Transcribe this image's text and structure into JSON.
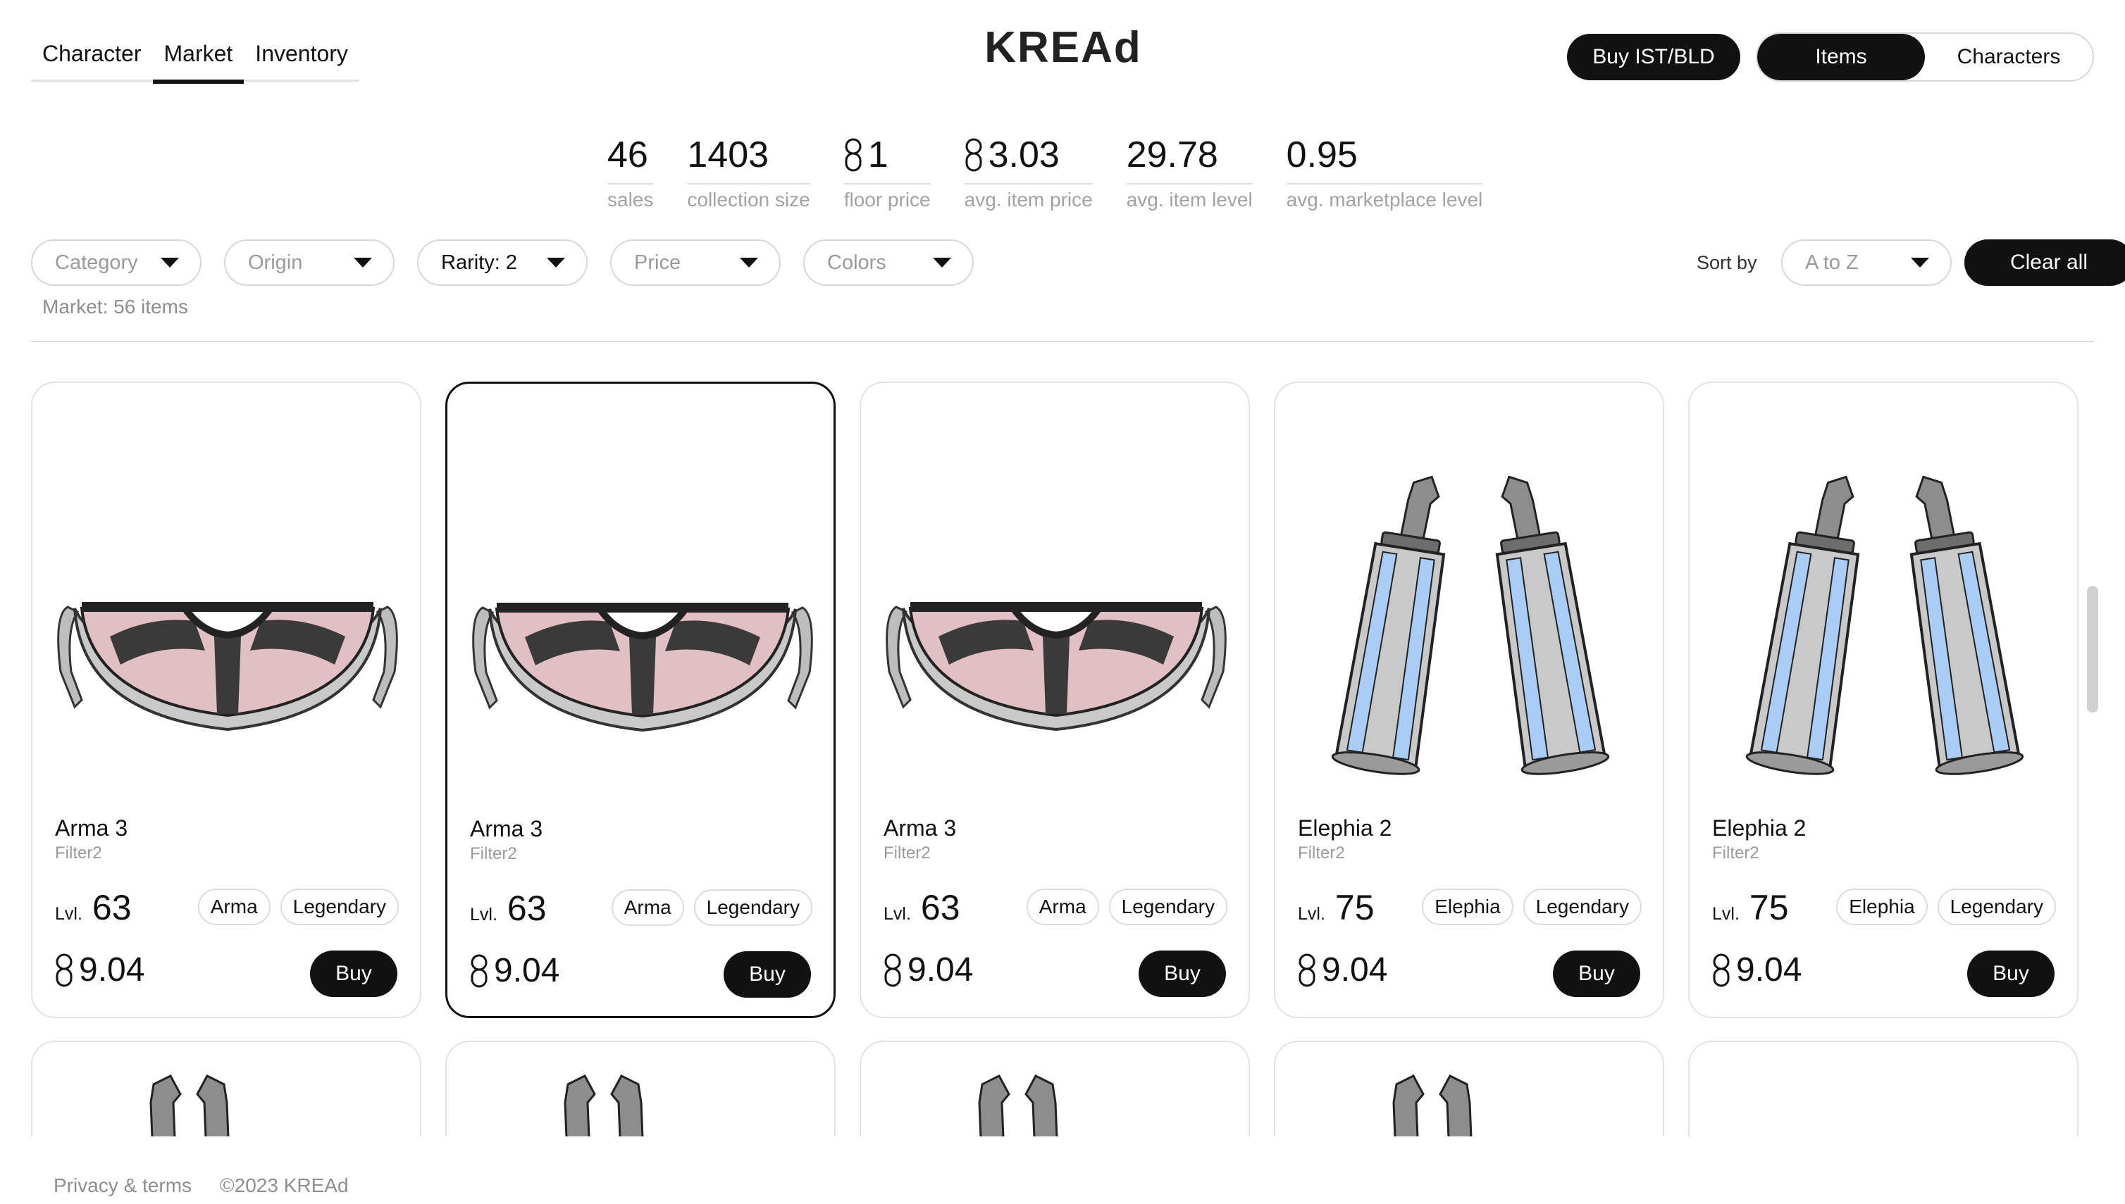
{
  "nav": {
    "tabs": [
      {
        "label": "Character",
        "active": false
      },
      {
        "label": "Market",
        "active": true
      },
      {
        "label": "Inventory",
        "active": false
      }
    ]
  },
  "logo": {
    "text": "KREAd"
  },
  "header": {
    "buy_label": "Buy IST/BLD",
    "segment": [
      {
        "label": "Items",
        "active": true
      },
      {
        "label": "Characters",
        "active": false
      }
    ]
  },
  "stats": [
    {
      "value": "46",
      "label": "sales",
      "coin": false
    },
    {
      "value": "1403",
      "label": "collection size",
      "coin": false
    },
    {
      "value": "1",
      "label": "floor price",
      "coin": true
    },
    {
      "value": "3.03",
      "label": "avg. item price",
      "coin": true
    },
    {
      "value": "29.78",
      "label": "avg. item level",
      "coin": false
    },
    {
      "value": "0.95",
      "label": "avg. marketplace level",
      "coin": false
    }
  ],
  "filters": {
    "category": "Category",
    "origin": "Origin",
    "rarity": "Rarity: 2",
    "price": "Price",
    "colors": "Colors",
    "sort_label": "Sort by",
    "sort_value": "A to Z",
    "clear_label": "Clear all",
    "market_count": "Market: 56 items"
  },
  "cards": [
    {
      "name": "Arma 3",
      "sub": "Filter2",
      "lvl_label": "Lvl.",
      "level": "63",
      "origin": "Arma",
      "rarity": "Legendary",
      "price": "9.04",
      "buy": "Buy",
      "kind": "mask",
      "selected": false
    },
    {
      "name": "Arma 3",
      "sub": "Filter2",
      "lvl_label": "Lvl.",
      "level": "63",
      "origin": "Arma",
      "rarity": "Legendary",
      "price": "9.04",
      "buy": "Buy",
      "kind": "mask",
      "selected": true
    },
    {
      "name": "Arma 3",
      "sub": "Filter2",
      "lvl_label": "Lvl.",
      "level": "63",
      "origin": "Arma",
      "rarity": "Legendary",
      "price": "9.04",
      "buy": "Buy",
      "kind": "mask",
      "selected": false
    },
    {
      "name": "Elephia 2",
      "sub": "Filter2",
      "lvl_label": "Lvl.",
      "level": "75",
      "origin": "Elephia",
      "rarity": "Legendary",
      "price": "9.04",
      "buy": "Buy",
      "kind": "tubes",
      "selected": false
    },
    {
      "name": "Elephia 2",
      "sub": "Filter2",
      "lvl_label": "Lvl.",
      "level": "75",
      "origin": "Elephia",
      "rarity": "Legendary",
      "price": "9.04",
      "buy": "Buy",
      "kind": "tubes",
      "selected": false
    }
  ],
  "footer": {
    "privacy": "Privacy & terms",
    "copyright": "©2023 KREAd"
  },
  "colors": {
    "accent": "#111111",
    "lens_pink": "#e2bfc2",
    "tube_blue": "#a9cdf5",
    "muted": "#9a9a9a"
  }
}
